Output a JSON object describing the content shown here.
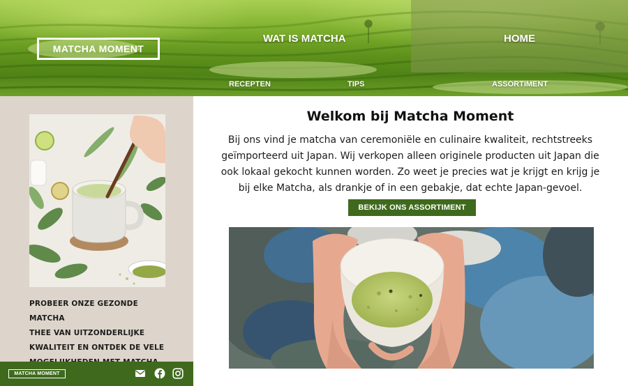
{
  "brand": {
    "logo_text": "MATCHA MOMENT"
  },
  "nav": {
    "wat_is_matcha": "WAT IS MATCHA",
    "home": "HOME",
    "recepten": "RECEPTEN",
    "tips": "TIPS",
    "assortiment": "ASSORTIMENT"
  },
  "sidebar": {
    "promo_lines": [
      "PROBEER ONZE GEZONDE MATCHA",
      "THEE VAN UITZONDERLIJKE",
      "KWALITEIT EN ONTDEK DE VELE",
      "MOGELIJKHEDEN MET MATCHA."
    ],
    "footer_logo": "MATCHA MOMENT",
    "social_icons": [
      "envelope-icon",
      "facebook-icon",
      "instagram-icon"
    ]
  },
  "main": {
    "title": "Welkom bij Matcha Moment",
    "intro_lines": [
      "Bij ons vind je matcha van ceremoniële en culinaire kwaliteit, rechtstreeks",
      "geïmporteerd uit Japan. Wij verkopen alleen originele producten uit Japan die",
      "ook lokaal gekocht kunnen worden. Zo weet je precies wat je krijgt en krijg je",
      "bij elke Matcha, als drankje of in een gebakje, dat echte Japan-gevoel."
    ],
    "cta_label": "BEKIJK ONS ASSORTIMENT"
  },
  "colors": {
    "brand_green": "#3f6a1d",
    "sidebar_bg": "#ddd5cb",
    "active_nav_overlay": "#8f9a58"
  }
}
